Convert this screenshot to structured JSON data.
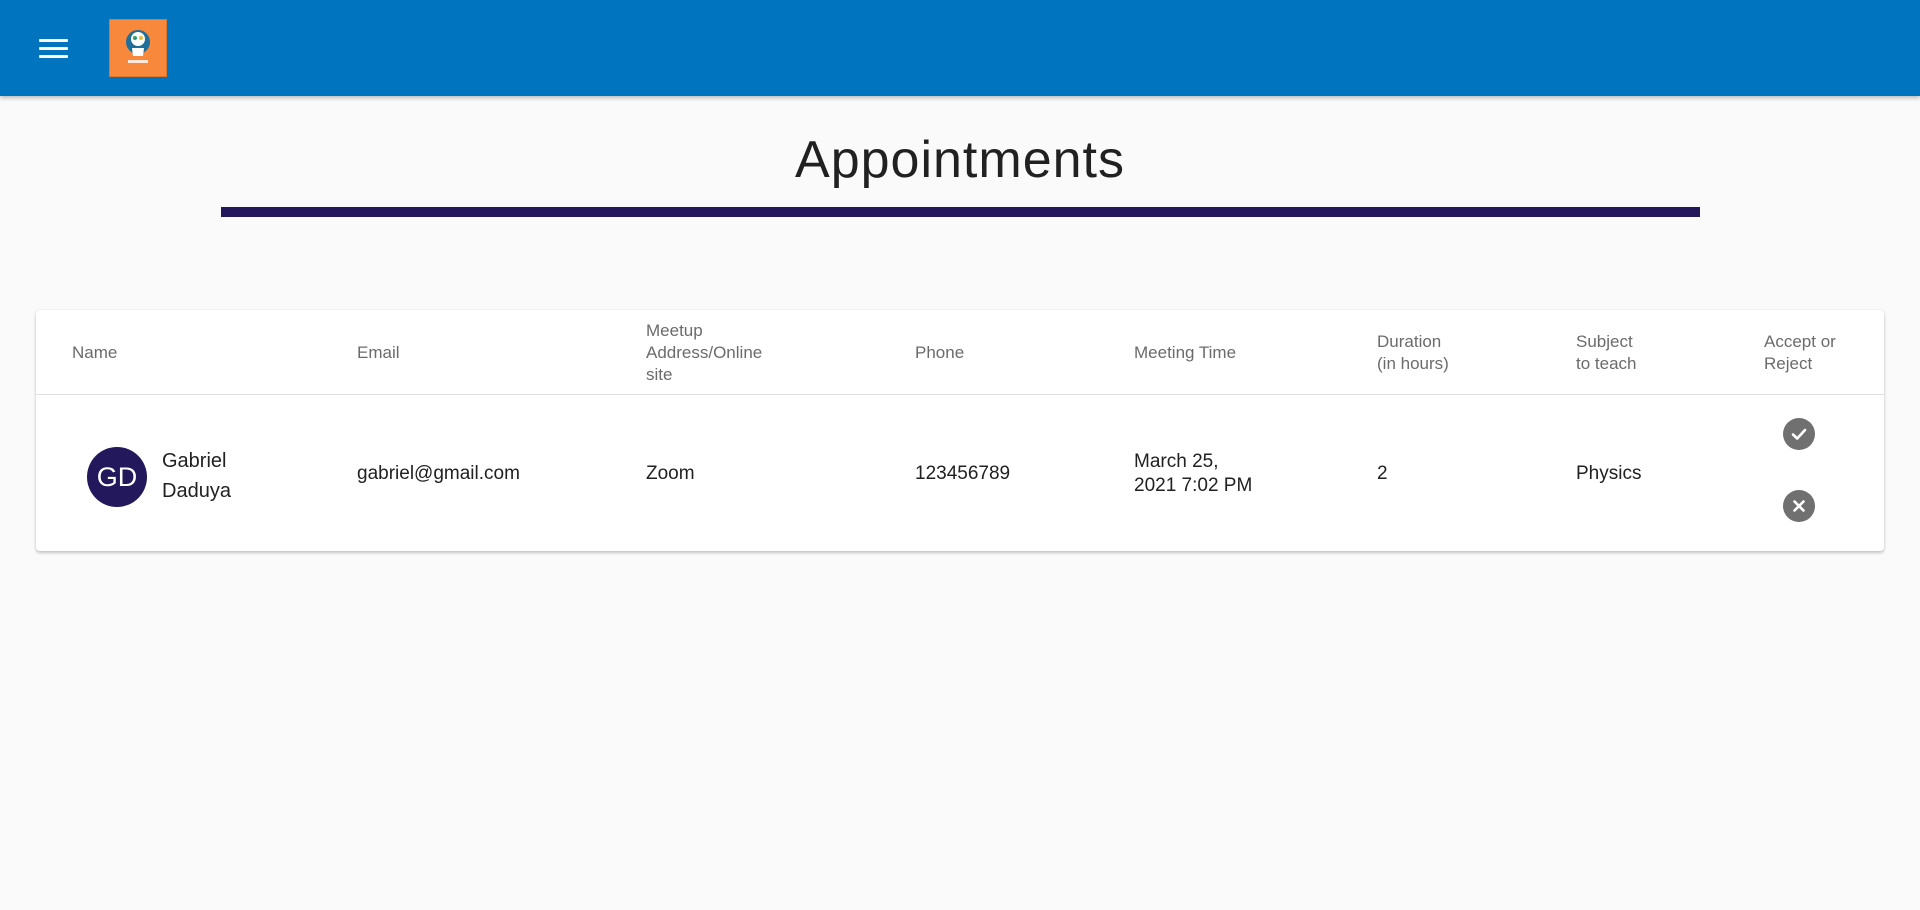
{
  "header": {
    "menu_icon": "hamburger-menu-icon",
    "logo_icon": "brain-logo-icon",
    "brand_color": "#0174bf"
  },
  "page": {
    "title": "Appointments",
    "rule_color": "#23185b"
  },
  "table": {
    "columns": {
      "name": "Name",
      "email": "Email",
      "address_1": "Meetup",
      "address_2": "Address/Online",
      "address_3": "site",
      "phone": "Phone",
      "meeting_time": "Meeting Time",
      "duration_1": "Duration",
      "duration_2": "(in hours)",
      "subject_1": "Subject",
      "subject_2": "to teach",
      "action_1": "Accept or",
      "action_2": "Reject"
    },
    "rows": [
      {
        "initials": "GD",
        "first_name": "Gabriel",
        "last_name": "Daduya",
        "email": "gabriel@gmail.com",
        "address": "Zoom",
        "phone": "123456789",
        "meeting_time_1": "March 25,",
        "meeting_time_2": "2021 7:02 PM",
        "duration": "2",
        "subject": "Physics",
        "accept_icon": "check-circle-icon",
        "reject_icon": "cancel-circle-icon"
      }
    ]
  }
}
